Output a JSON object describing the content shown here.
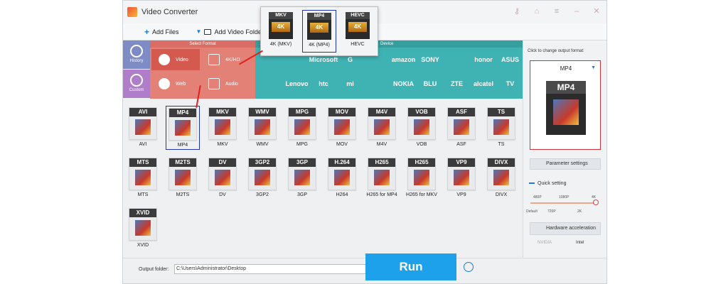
{
  "app": {
    "title": "Video Converter"
  },
  "toolbar": {
    "add_files": "Add Files",
    "add_video_folder": "Add Video Folder"
  },
  "sidebar": {
    "history": "History",
    "custom": "Custom"
  },
  "format_panel": {
    "select_format": "Select Format",
    "device": "Device",
    "categories": [
      "Video",
      "4K/HD",
      "Web",
      "Audio"
    ]
  },
  "devices": [
    "",
    "",
    "Microsoft",
    "G",
    "",
    "amazon",
    "SONY",
    "",
    "honor",
    "ASUS",
    "",
    "Lenovo",
    "htc",
    "mi",
    "",
    "NOKIA",
    "BLU",
    "ZTE",
    "alcatel",
    "TV"
  ],
  "popup": {
    "items": [
      {
        "cap": "MKV",
        "badge": "4K",
        "label": "4K (MKV)"
      },
      {
        "cap": "MP4",
        "badge": "4K",
        "label": "4K (MP4)"
      },
      {
        "cap": "HEVC",
        "badge": "4K",
        "label": "HEVC"
      }
    ]
  },
  "formats": [
    {
      "cap": "AVI",
      "label": "AVI"
    },
    {
      "cap": "MP4",
      "label": "MP4"
    },
    {
      "cap": "MKV",
      "label": "MKV"
    },
    {
      "cap": "WMV",
      "label": "WMV"
    },
    {
      "cap": "MPG",
      "label": "MPG"
    },
    {
      "cap": "MOV",
      "label": "MOV"
    },
    {
      "cap": "M4V",
      "label": "M4V"
    },
    {
      "cap": "VOB",
      "label": "VOB"
    },
    {
      "cap": "ASF",
      "label": "ASF"
    },
    {
      "cap": "TS",
      "label": "TS"
    },
    {
      "cap": "MTS",
      "label": "MTS"
    },
    {
      "cap": "M2TS",
      "label": "M2TS"
    },
    {
      "cap": "DV",
      "label": "DV"
    },
    {
      "cap": "3GP2",
      "label": "3GP2"
    },
    {
      "cap": "3GP",
      "label": "3GP"
    },
    {
      "cap": "H.264",
      "label": "H264"
    },
    {
      "cap": "H265",
      "label": "H265 for MP4"
    },
    {
      "cap": "H265",
      "label": "H265 for MKV"
    },
    {
      "cap": "VP9",
      "label": "VP9"
    },
    {
      "cap": "DIVX",
      "label": "DIVX"
    },
    {
      "cap": "XVID",
      "label": "XVID"
    }
  ],
  "right_panel": {
    "click_label": "Click to change output format:",
    "output_format": "MP4",
    "param_settings": "Parameter settings",
    "quick_setting": "Quick setting",
    "ticks_top": [
      "480P",
      "1080P",
      "4K"
    ],
    "ticks_bottom": [
      "Default",
      "720P",
      "2K"
    ],
    "hw_accel": "Hardware acceleration",
    "vendors": [
      "NVIDIA",
      "Intel"
    ]
  },
  "bottom": {
    "output_folder_label": "Output folder:",
    "path": "C:\\Users\\Administrator\\Desktop",
    "run": "Run"
  }
}
